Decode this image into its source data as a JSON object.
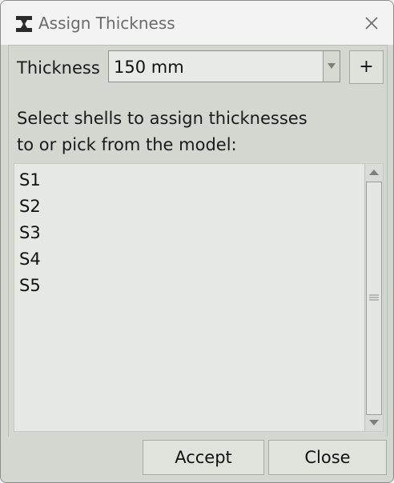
{
  "window": {
    "title": "Assign Thickness",
    "icon": "beam-section-icon",
    "close_icon": "close-icon"
  },
  "thickness": {
    "label": "Thickness",
    "selected": "150 mm",
    "add_label": "+"
  },
  "instruction": {
    "line1": "Select shells to assign thicknesses",
    "line2": "to or pick from the model:"
  },
  "shells": [
    {
      "label": "S1"
    },
    {
      "label": "S2"
    },
    {
      "label": "S3"
    },
    {
      "label": "S4"
    },
    {
      "label": "S5"
    }
  ],
  "footer": {
    "accept_label": "Accept",
    "close_label": "Close"
  },
  "colors": {
    "window_bg": "#d4d7d0",
    "titlebar_bg": "#f3f3f3",
    "list_bg": "#e6e9e3"
  }
}
